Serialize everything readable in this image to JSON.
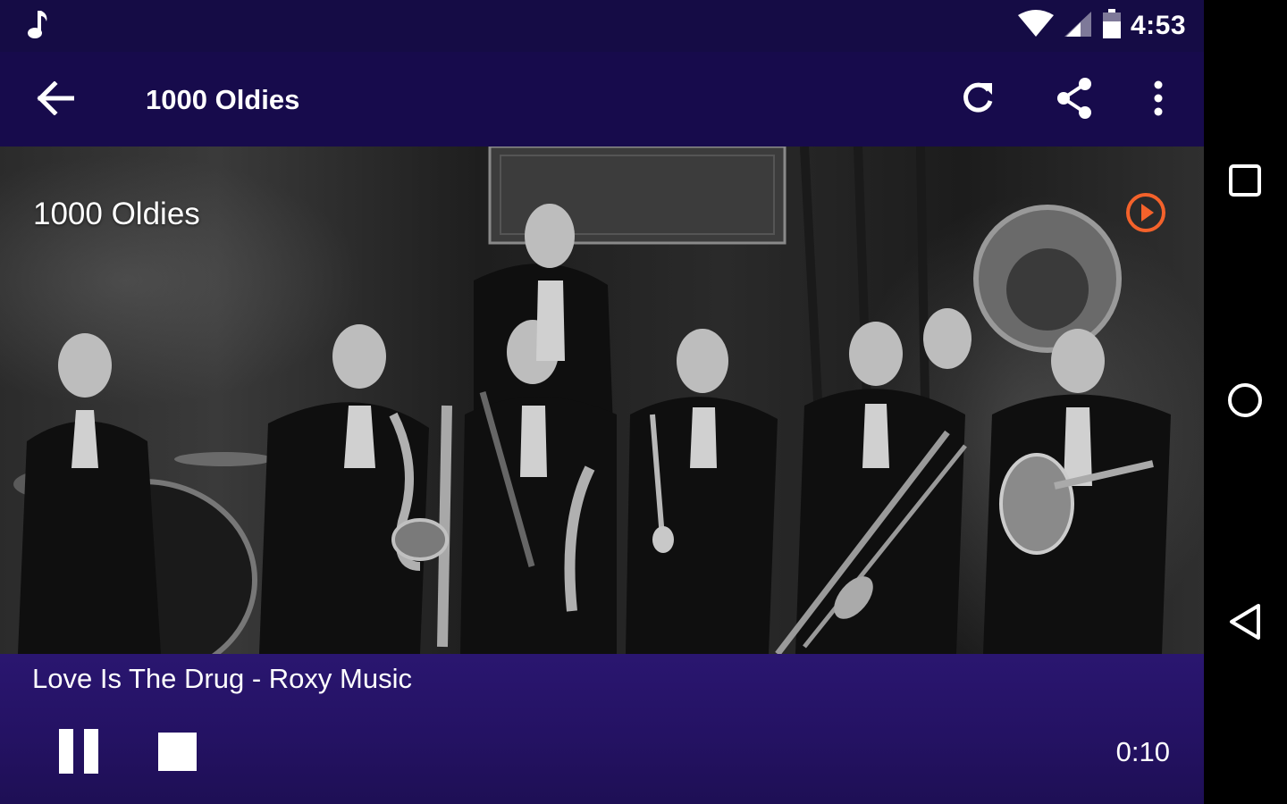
{
  "status_bar": {
    "time": "4:53",
    "icons": [
      "music-note-icon",
      "wifi-icon",
      "signal-icon",
      "battery-icon"
    ]
  },
  "app_bar": {
    "title": "1000 Oldies",
    "actions": [
      "refresh-icon",
      "share-icon",
      "more-vert-icon"
    ]
  },
  "hero": {
    "station_name": "1000 Oldies",
    "accent_color": "#f4622b"
  },
  "player": {
    "track": "Love Is The Drug - Roxy Music",
    "elapsed": "0:10"
  },
  "nav": {
    "buttons": [
      "recents-icon",
      "home-icon",
      "back-icon"
    ]
  },
  "colors": {
    "status_bar": "#150c45",
    "app_bar": "#170b4c",
    "player_bg": "#241263"
  }
}
